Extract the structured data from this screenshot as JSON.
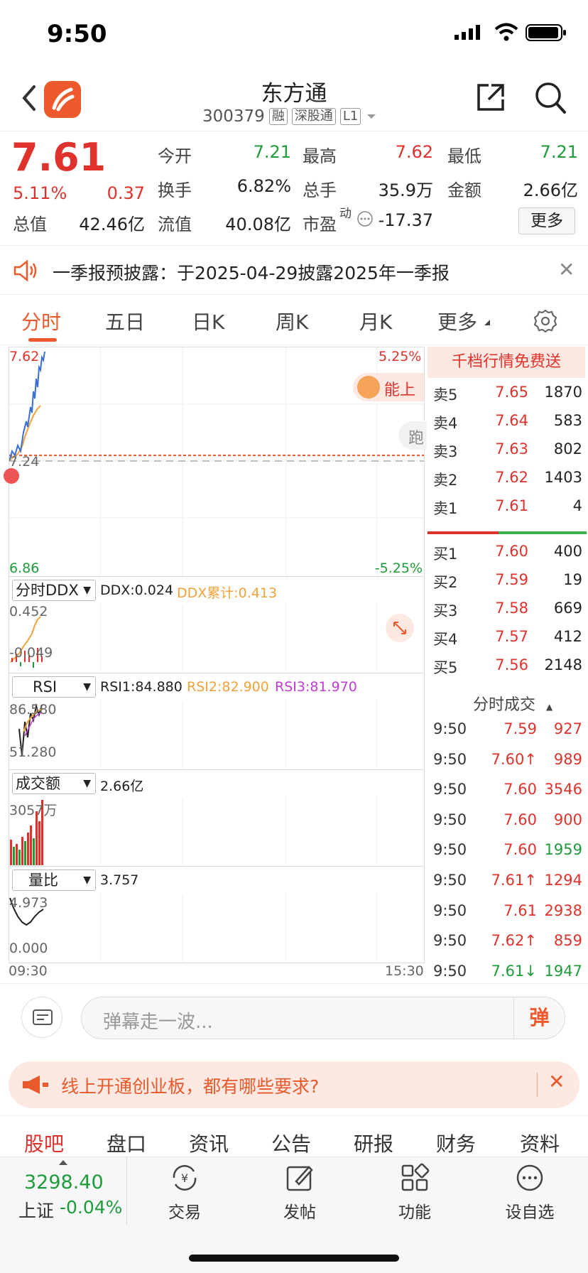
{
  "status": {
    "time": "9:50"
  },
  "header": {
    "stock_name": "东方通",
    "code": "300379",
    "tags": [
      "融",
      "深股通",
      "L1"
    ]
  },
  "quote": {
    "price": "7.61",
    "change_pct": "5.11%",
    "change": "0.37",
    "open_label": "今开",
    "open": "7.21",
    "high_label": "最高",
    "high": "7.62",
    "low_label": "最低",
    "low": "7.21",
    "turnover_rate_label": "换手",
    "turnover_rate": "6.82%",
    "volume_label": "总手",
    "volume": "35.9万",
    "amount_label": "金额",
    "amount": "2.66亿",
    "mktcap_label": "总值",
    "mktcap": "42.46亿",
    "float_label": "流值",
    "float": "40.08亿",
    "pe_label": "市盈",
    "pe_sup": "动",
    "pe": "-17.37",
    "more_label": "更多"
  },
  "notice": {
    "text": "一季报预披露：于2025-04-29披露2025年一季报"
  },
  "tabs": [
    "分时",
    "五日",
    "日K",
    "周K",
    "月K",
    "更多"
  ],
  "main_chart": {
    "ymax": "7.62",
    "ymid": "7.24",
    "ymin": "6.86",
    "pct_max": "5.25%",
    "pct_min": "-5.25%",
    "popup_label": "能上",
    "side_label": "跑",
    "start_time": "09:30",
    "end_time": "15:30"
  },
  "indicators": {
    "ddx": {
      "select": "分时DDX",
      "ddx": "DDX:0.024",
      "ddx_cum": "DDX累计:0.413",
      "top": "0.452",
      "bottom": "-0.049"
    },
    "rsi": {
      "select": "RSI",
      "rsi1": "RSI1:84.880",
      "rsi2": "RSI2:82.900",
      "rsi3": "RSI3:81.970",
      "top": "86.580",
      "bottom": "51.280"
    },
    "amount": {
      "select": "成交额",
      "value": "2.66亿",
      "top": "3057万"
    },
    "ratio": {
      "select": "量比",
      "value": "3.757",
      "top": "4.973",
      "bottom": "0.000"
    }
  },
  "order_book": {
    "promo": "千档行情免费送",
    "asks": [
      {
        "label": "卖5",
        "price": "7.65",
        "vol": "1870"
      },
      {
        "label": "卖4",
        "price": "7.64",
        "vol": "583"
      },
      {
        "label": "卖3",
        "price": "7.63",
        "vol": "802"
      },
      {
        "label": "卖2",
        "price": "7.62",
        "vol": "1403"
      },
      {
        "label": "卖1",
        "price": "7.61",
        "vol": "4"
      }
    ],
    "bids": [
      {
        "label": "买1",
        "price": "7.60",
        "vol": "400"
      },
      {
        "label": "买2",
        "price": "7.59",
        "vol": "19"
      },
      {
        "label": "买3",
        "price": "7.58",
        "vol": "669"
      },
      {
        "label": "买4",
        "price": "7.57",
        "vol": "412"
      },
      {
        "label": "买5",
        "price": "7.56",
        "vol": "2148"
      }
    ],
    "trades_title": "分时成交",
    "trades": [
      {
        "time": "9:50",
        "price": "7.59",
        "vol": "927",
        "color": "red"
      },
      {
        "time": "9:50",
        "price": "7.60↑",
        "vol": "989",
        "color": "red"
      },
      {
        "time": "9:50",
        "price": "7.60",
        "vol": "3546",
        "color": "red"
      },
      {
        "time": "9:50",
        "price": "7.60",
        "vol": "900",
        "color": "red"
      },
      {
        "time": "9:50",
        "price": "7.60",
        "vol": "1959",
        "color": "green"
      },
      {
        "time": "9:50",
        "price": "7.61↑",
        "vol": "1294",
        "color": "red"
      },
      {
        "time": "9:50",
        "price": "7.61",
        "vol": "2938",
        "color": "red"
      },
      {
        "time": "9:50",
        "price": "7.62↑",
        "vol": "859",
        "color": "red"
      },
      {
        "time": "9:50",
        "price": "7.61↓",
        "vol": "1947",
        "color": "green"
      }
    ]
  },
  "danmu": {
    "placeholder": "弹幕走一波...",
    "button": "弹"
  },
  "banner": {
    "text": "线上开通创业板，都有哪些要求?"
  },
  "subtabs": [
    "股吧",
    "盘口",
    "资讯",
    "公告",
    "研报",
    "财务",
    "资料"
  ],
  "tabbar": {
    "index_value": "3298.40",
    "index_name": "上证",
    "index_pct": "-0.04%",
    "items": [
      "交易",
      "发帖",
      "功能",
      "设自选"
    ]
  },
  "colors": {
    "up": "#e0322c",
    "down": "#1e9c3a",
    "accent": "#ee5a2c",
    "avg_line": "#f2a23a",
    "price_line": "#3b6fd4"
  }
}
